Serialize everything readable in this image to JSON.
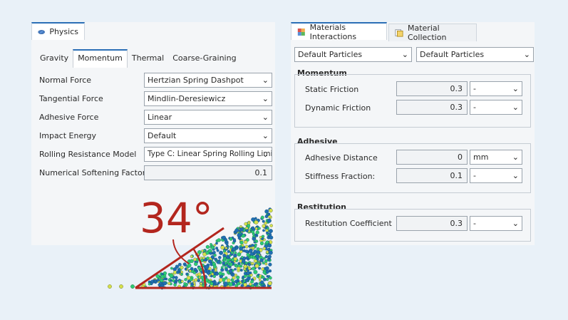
{
  "physics": {
    "tab_label": "Physics",
    "subtabs": [
      "Gravity",
      "Momentum",
      "Thermal",
      "Coarse-Graining"
    ],
    "rows": [
      {
        "label": "Normal Force",
        "value": "Hertzian Spring Dashpot"
      },
      {
        "label": "Tangential Force",
        "value": "Mindlin-Deresiewicz"
      },
      {
        "label": "Adhesive Force",
        "value": "Linear"
      },
      {
        "label": "Impact Energy",
        "value": "Default"
      },
      {
        "label": "Rolling Resistance Model",
        "value": "Type C: Linear Spring Rolling Limit"
      },
      {
        "label": "Numerical Softening Factor",
        "value": "0.1"
      }
    ]
  },
  "illustration": {
    "angle_text": "34°",
    "angle_deg": 34,
    "colors": {
      "accent": "#c0392b",
      "particles_a": "#2ecc71",
      "particles_b": "#1f6fb2",
      "particles_c": "#d7e04a"
    }
  },
  "materials": {
    "tab_materials_interactions": "Materials Interactions",
    "tab_material_collection": "Material Collection",
    "particle_a": "Default Particles",
    "particle_b": "Default Particles",
    "momentum": {
      "title": "Momentum",
      "rows": [
        {
          "label": "Static Friction",
          "value": "0.3",
          "unit": "-"
        },
        {
          "label": "Dynamic Friction",
          "value": "0.3",
          "unit": "-"
        }
      ]
    },
    "adhesive": {
      "title": "Adhesive",
      "rows": [
        {
          "label": "Adhesive Distance",
          "value": "0",
          "unit": "mm"
        },
        {
          "label": "Stiffness Fraction:",
          "value": "0.1",
          "unit": "-"
        }
      ]
    },
    "restitution": {
      "title": "Restitution",
      "rows": [
        {
          "label": "Restitution Coefficient",
          "value": "0.3",
          "unit": "-"
        }
      ]
    }
  }
}
